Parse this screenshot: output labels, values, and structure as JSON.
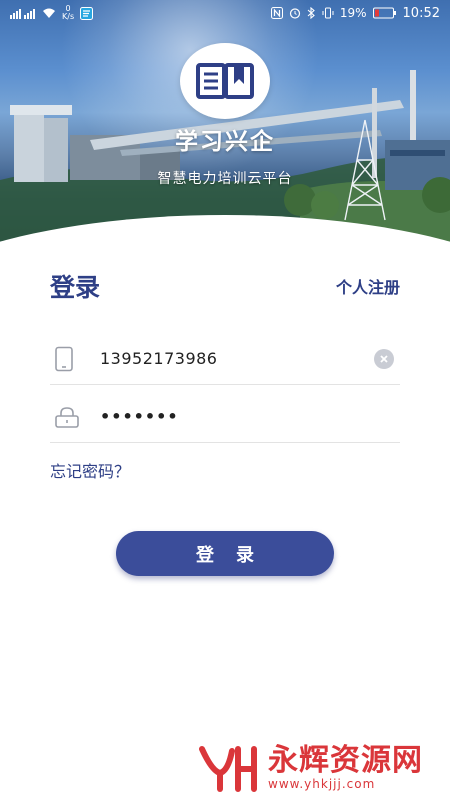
{
  "status_bar": {
    "speed_value": "0",
    "speed_unit": "K/s",
    "battery_percent": "19%",
    "time": "10:52"
  },
  "header": {
    "app_title": "学习兴企",
    "app_subtitle": "智慧电力培训云平台"
  },
  "login": {
    "heading": "登录",
    "register_label": "个人注册",
    "phone_value": "13952173986",
    "password_value": "•••••••",
    "forgot_label": "忘记密码？",
    "submit_label": "登录"
  },
  "watermark": {
    "name": "永辉资源网",
    "url": "www.yhkjjj.com"
  },
  "colors": {
    "accent": "#2e3f86",
    "button": "#3b4d9a",
    "watermark": "#d7262a"
  }
}
